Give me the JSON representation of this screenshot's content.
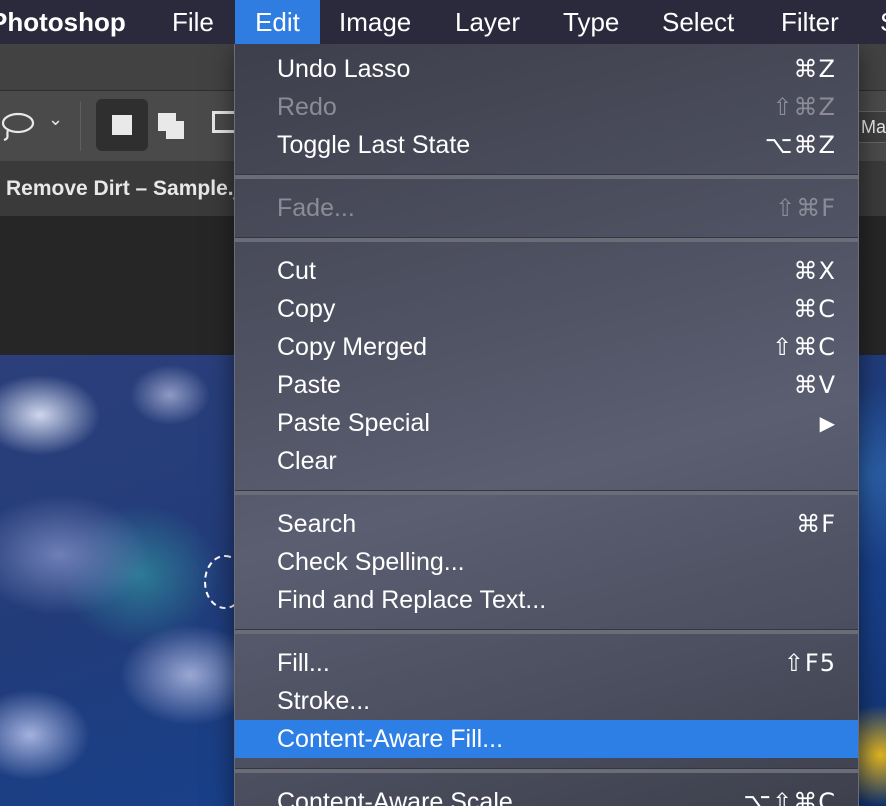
{
  "menubar": {
    "app_name": "Photoshop",
    "items": [
      "File",
      "Edit",
      "Image",
      "Layer",
      "Type",
      "Select",
      "Filter",
      "S"
    ],
    "active": "Edit"
  },
  "options_bar": {
    "lasso_chevron": "⌄",
    "mask_button_fragment": "Mask"
  },
  "document": {
    "tab_title": "Remove Dirt – Sample.jpg"
  },
  "edit_menu": {
    "undo": {
      "label": "Undo Lasso",
      "shortcut": "⌘Z"
    },
    "redo": {
      "label": "Redo",
      "shortcut": "⇧⌘Z",
      "disabled": true
    },
    "toggle_last_state": {
      "label": "Toggle Last State",
      "shortcut": "⌥⌘Z"
    },
    "fade": {
      "label": "Fade...",
      "shortcut": "⇧⌘F",
      "disabled": true
    },
    "cut": {
      "label": "Cut",
      "shortcut": "⌘X"
    },
    "copy": {
      "label": "Copy",
      "shortcut": "⌘C"
    },
    "copy_merged": {
      "label": "Copy Merged",
      "shortcut": "⇧⌘C"
    },
    "paste": {
      "label": "Paste",
      "shortcut": "⌘V"
    },
    "paste_special": {
      "label": "Paste Special",
      "shortcut": "▶"
    },
    "clear": {
      "label": "Clear",
      "shortcut": ""
    },
    "search": {
      "label": "Search",
      "shortcut": "⌘F"
    },
    "check_spelling": {
      "label": "Check Spelling...",
      "shortcut": ""
    },
    "find_replace": {
      "label": "Find and Replace Text...",
      "shortcut": ""
    },
    "fill": {
      "label": "Fill...",
      "shortcut": "⇧F5"
    },
    "stroke": {
      "label": "Stroke...",
      "shortcut": ""
    },
    "content_aware_fill": {
      "label": "Content-Aware Fill...",
      "shortcut": "",
      "highlighted": true
    },
    "content_aware_scale": {
      "label": "Content-Aware Scale",
      "shortcut": "⌥⇧⌘C"
    }
  },
  "colors": {
    "menubar_bg": "#2a2a3c",
    "active_menu_bg": "#2f7de1",
    "highlight_bg": "#2d7fe6",
    "disabled_text": "#8b8c96"
  }
}
